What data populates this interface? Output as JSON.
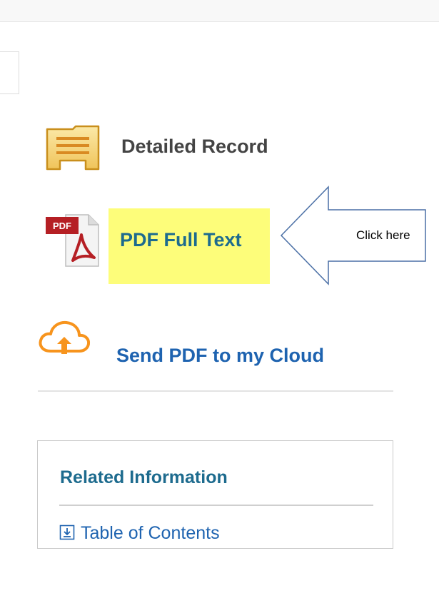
{
  "actions": {
    "detailed_record": {
      "label": "Detailed Record",
      "icon": "detailed-record-icon"
    },
    "pdf_full_text": {
      "label": "PDF Full Text",
      "icon": "pdf-file-icon",
      "highlight_color": "#fdfd7a"
    },
    "send_to_cloud": {
      "label": "Send PDF to my Cloud",
      "icon": "cloud-upload-icon"
    }
  },
  "related": {
    "heading": "Related Information",
    "links": [
      {
        "label": "Table of Contents",
        "icon": "download-box-icon"
      }
    ]
  },
  "callout": {
    "text": "Click here"
  },
  "colors": {
    "link_teal": "#1d6b8e",
    "link_blue": "#1e63b0",
    "cloud_orange": "#f7941d",
    "pdf_red": "#b51f24"
  }
}
